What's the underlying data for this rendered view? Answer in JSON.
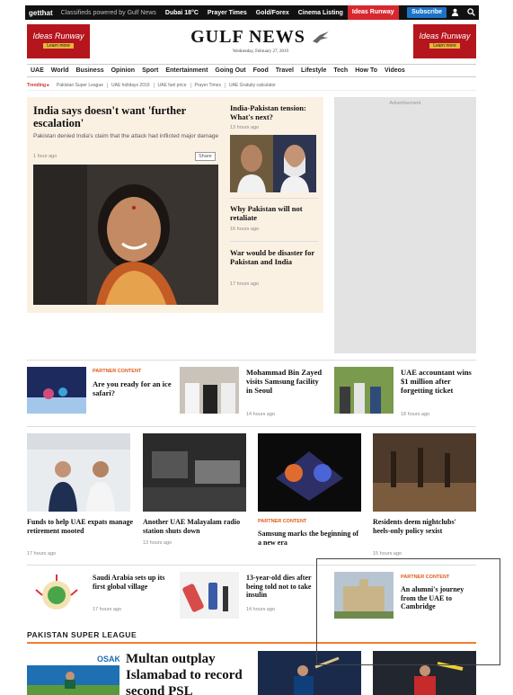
{
  "topbar": {
    "logo": "getthat",
    "classifieds": "Classifieds powered by Gulf News",
    "weather": "Dubai 18°C",
    "links": [
      "Prayer Times",
      "Gold/Forex",
      "Cinema Listing"
    ],
    "highlight": "Ideas Runway",
    "subscribe": "Subscribe",
    "user_icon": "user-icon",
    "search_icon": "search-icon"
  },
  "ads": {
    "brand": "Ideas Runway",
    "cta": "Learn more"
  },
  "masthead": {
    "title": "GULF NEWS",
    "date": "Wednesday, February 27, 2019",
    "logo_icon": "falcon-icon"
  },
  "nav": [
    "UAE",
    "World",
    "Business",
    "Opinion",
    "Sport",
    "Entertainment",
    "Going Out",
    "Food",
    "Travel",
    "Lifestyle",
    "Tech",
    "How To",
    "Videos"
  ],
  "trending": {
    "label": "Trending",
    "items": [
      "Pakistan Super League",
      "UAE holidays 2019",
      "UAE fuel price",
      "Prayer Times",
      "UAE Gratuity calculator"
    ]
  },
  "featured": {
    "title": "India says doesn't want 'further escalation'",
    "summary": "Pakistan denied India's claim that the attack had inflicted major damage",
    "time": "1 hour ago",
    "share": "Share"
  },
  "side_stories": [
    {
      "title": "India-Pakistan tension: What's next?",
      "time": "13 hours ago"
    },
    {
      "title": "Why Pakistan will not retaliate",
      "time": "16 hours ago"
    },
    {
      "title": "War would be disaster for Pakistan and India",
      "time": "17 hours ago"
    }
  ],
  "advertisement": "Advertisement",
  "row1": [
    {
      "tag": "PARTNER CONTENT",
      "title": "Are you ready for an ice safari?"
    },
    {
      "title": "Mohammad Bin Zayed visits Samsung facility in Seoul",
      "time": "14 hours ago"
    },
    {
      "title": "UAE accountant wins $1 million after forgetting ticket",
      "time": "18 hours ago"
    }
  ],
  "row2": [
    {
      "title": "Funds to help UAE expats manage retirement mooted",
      "time": "17 hours ago"
    },
    {
      "title": "Another UAE Malayalam radio station shuts down",
      "time": "13 hours ago"
    },
    {
      "tag": "PARTNER CONTENT",
      "title": "Samsung marks the beginning of a new era"
    },
    {
      "title": "Residents deem nightclubs' heels-only policy sexist",
      "time": "15 hours ago"
    }
  ],
  "row3": [
    {
      "title": "Saudi Arabia sets up its first global village",
      "time": "17 hours ago"
    },
    {
      "title": "13-year-old dies after being told not to take insulin",
      "time": "14 hours ago"
    },
    {
      "tag": "PARTNER CONTENT",
      "title": "An alumni's journey from the UAE to Cambridge"
    }
  ],
  "section": {
    "title": "PAKISTAN SUPER LEAGUE",
    "lead": "Multan outplay Islamabad to record second PSL",
    "sponsor": "OSAKA"
  }
}
